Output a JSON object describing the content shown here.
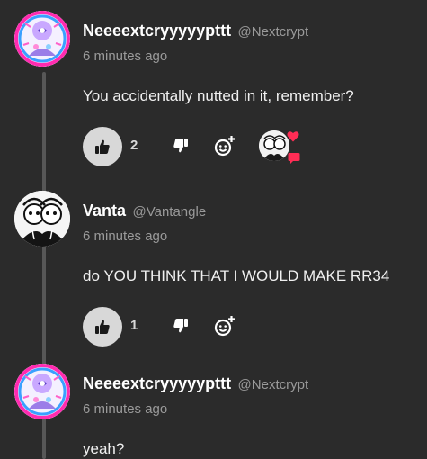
{
  "comments": [
    {
      "username": "Neeeextcryyyyypttt",
      "handle": "@Nextcrypt",
      "time": "6 minutes ago",
      "text": "You accidentally nutted in it, remember?",
      "likes": "2"
    },
    {
      "username": "Vanta",
      "handle": "@Vantangle",
      "time": "6 minutes ago",
      "text": "do YOU THINK THAT I WOULD MAKE RR34",
      "likes": "1"
    },
    {
      "username": "Neeeextcryyyyypttt",
      "handle": "@Nextcrypt",
      "time": "6 minutes ago",
      "text": "yeah?"
    }
  ],
  "icons": {
    "like": "thumbs-up-icon",
    "dislike": "thumbs-down-icon",
    "react": "add-reaction-icon",
    "heart": "heart-icon",
    "reply": "speech-bubble-icon"
  },
  "colors": {
    "background": "#2b2b2b",
    "like_button": "#d8d8d8",
    "reaction_accent": "#ff2d55",
    "muted_text": "#9a9a9a"
  }
}
